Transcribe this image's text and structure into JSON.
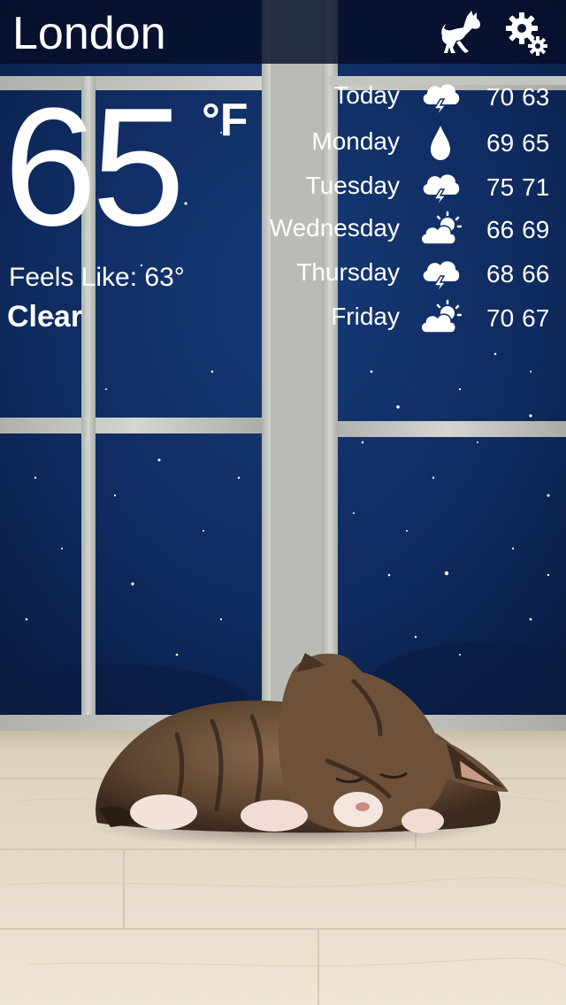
{
  "header": {
    "city": "London",
    "pet_icon": "cat-icon",
    "settings_icon": "gear-icon"
  },
  "current": {
    "temperature": "65",
    "unit": "°F",
    "feels_like_label": "Feels Like: ",
    "feels_like_value": "63°",
    "condition": "Clear"
  },
  "forecast": [
    {
      "day": "Today",
      "icon": "thunderstorm-icon",
      "high": "70",
      "low": "63"
    },
    {
      "day": "Monday",
      "icon": "raindrop-icon",
      "high": "69",
      "low": "65"
    },
    {
      "day": "Tuesday",
      "icon": "thunderstorm-icon",
      "high": "75",
      "low": "71"
    },
    {
      "day": "Wednesday",
      "icon": "partly-cloudy-icon",
      "high": "66",
      "low": "69"
    },
    {
      "day": "Thursday",
      "icon": "thunderstorm-icon",
      "high": "68",
      "low": "66"
    },
    {
      "day": "Friday",
      "icon": "partly-cloudy-icon",
      "high": "70",
      "low": "67"
    }
  ],
  "colors": {
    "night_sky": "#0d2350",
    "window_frame": "#c9cbc5",
    "floor": "#e3d8c6",
    "text": "#ffffff"
  }
}
